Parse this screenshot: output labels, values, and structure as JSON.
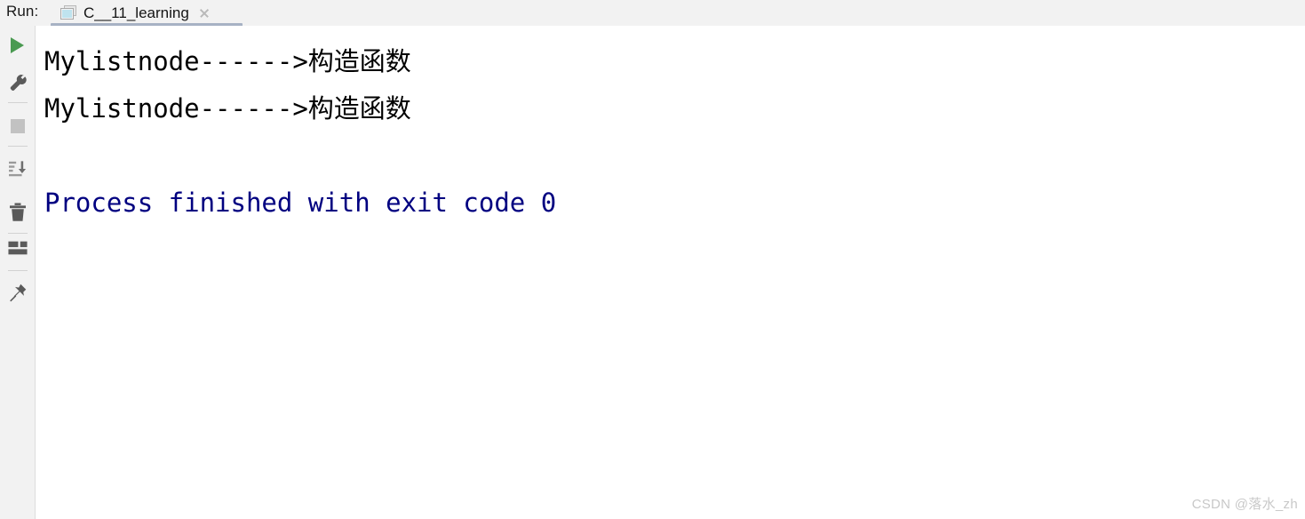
{
  "window": {
    "background": "#ffffff",
    "header_background": "#f2f2f2"
  },
  "header": {
    "run_label": "Run:",
    "tab": {
      "title": "C__11_learning",
      "icon": "console-window-icon",
      "close_icon": "close-icon",
      "active": true,
      "underline_color": "#a7b2c4"
    }
  },
  "toolbar": {
    "items": [
      {
        "name": "rerun-button",
        "icon": "play-icon",
        "label": "Rerun",
        "color": "#4a9a51",
        "enabled": true
      },
      {
        "name": "configure-button",
        "icon": "wrench-icon",
        "label": "Edit Configuration",
        "color": "#5a5a5a",
        "enabled": true
      },
      {
        "name": "stop-button",
        "icon": "stop-square-icon",
        "label": "Stop",
        "color": "#c2c2c2",
        "enabled": false
      },
      {
        "name": "scroll-to-end-button",
        "icon": "sort-down-icon",
        "label": "Scroll to End",
        "color": "#8a8a8a",
        "enabled": true
      },
      {
        "name": "clear-all-button",
        "icon": "trash-icon",
        "label": "Clear All",
        "color": "#5a5a5a",
        "enabled": true
      },
      {
        "name": "layout-button",
        "icon": "layout-grid-icon",
        "label": "Layout",
        "color": "#5a5a5a",
        "enabled": true
      },
      {
        "name": "pin-tab-button",
        "icon": "pin-icon",
        "label": "Pin Tab",
        "color": "#5a5a5a",
        "enabled": true
      }
    ]
  },
  "console": {
    "background": "#ffffff",
    "stdout_color": "#000000",
    "exit_color": "#000080",
    "lines": [
      {
        "text": "Mylistnode------>构造函数",
        "type": "stdout"
      },
      {
        "text": "Mylistnode------>构造函数",
        "type": "stdout"
      },
      {
        "text": "",
        "type": "blank"
      },
      {
        "text": "Process finished with exit code 0",
        "type": "exit"
      }
    ]
  },
  "watermark": {
    "text": "CSDN @落水_zh",
    "color": "#c8c8c8"
  }
}
